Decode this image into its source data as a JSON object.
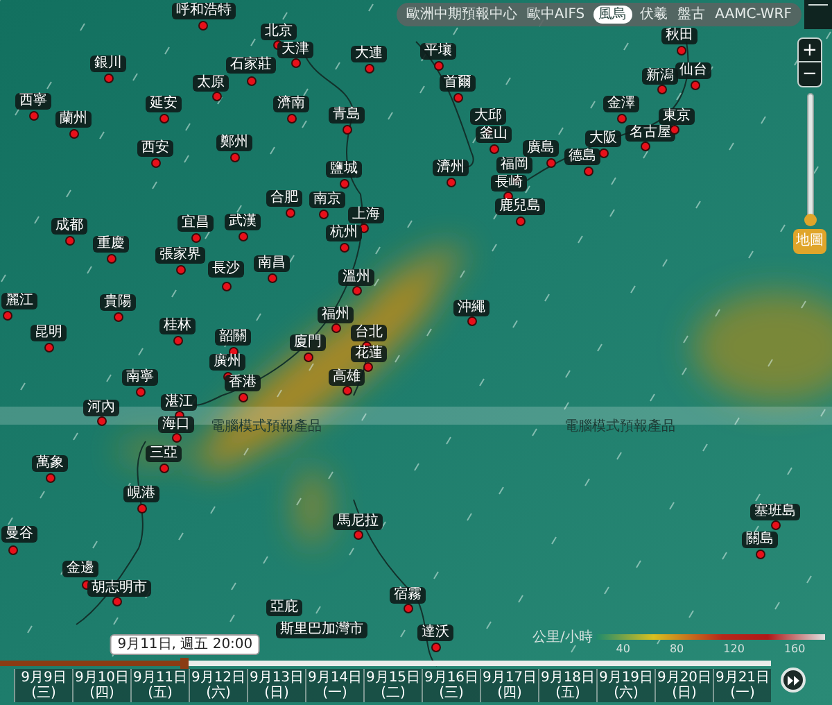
{
  "model_tabs": [
    {
      "label": "歐洲中期預報中心",
      "selected": false
    },
    {
      "label": "歐中AIFS",
      "selected": false
    },
    {
      "label": "風烏",
      "selected": true
    },
    {
      "label": "伏羲",
      "selected": false
    },
    {
      "label": "盤古",
      "selected": false
    },
    {
      "label": "AAMC-WRF",
      "selected": false
    }
  ],
  "zoom_controls": {
    "zoom_in": "+",
    "zoom_out": "−",
    "zoom_level": {
      "level": 0
    }
  },
  "layer_button": "地圖",
  "cities": [
    "呼和浩特",
    "北京",
    "天津",
    "大連",
    "銀川",
    "石家莊",
    "太原",
    "西寧",
    "延安",
    "濟南",
    "蘭州",
    "青島",
    "西安",
    "鄭州",
    "鹽城",
    "合肥",
    "南京",
    "上海",
    "成都",
    "宜昌",
    "武漢",
    "杭州",
    "重慶",
    "張家界",
    "長沙",
    "南昌",
    "溫州",
    "麗江",
    "貴陽",
    "福州",
    "桂林",
    "昆明",
    "韶關",
    "廈門",
    "台北",
    "花蓮",
    "廣州",
    "南寧",
    "香港",
    "高雄",
    "湛江",
    "河內",
    "海口",
    "三亞",
    "萬象",
    "峴港",
    "曼谷",
    "金邊",
    "胡志明市",
    "馬尼拉",
    "宿霧",
    "達沃",
    "亞庇",
    "斯里巴加灣市",
    "沖繩",
    "平壤",
    "首爾",
    "大邱",
    "釜山",
    "濟州",
    "福岡",
    "長崎",
    "鹿兒島",
    "廣島",
    "德島",
    "大阪",
    "名古屋",
    "金澤",
    "新潟",
    "仙台",
    "東京",
    "秋田",
    "塞班島",
    "關島"
  ],
  "overlay_banners": [
    "電腦模式預報產品",
    "電腦模式預報產品"
  ],
  "legend": {
    "unit": "公里/小時",
    "ticks": [
      "40",
      "80",
      "120",
      "160"
    ]
  },
  "timeline": {
    "level": 0.24,
    "tooltip": "9月11日, 週五 20:00",
    "days": [
      {
        "date": "9月9日",
        "weekday": "(三)"
      },
      {
        "date": "9月10日",
        "weekday": "(四)"
      },
      {
        "date": "9月11日",
        "weekday": "(五)"
      },
      {
        "date": "9月12日",
        "weekday": "(六)"
      },
      {
        "date": "9月13日",
        "weekday": "(日)"
      },
      {
        "date": "9月14日",
        "weekday": "(一)"
      },
      {
        "date": "9月15日",
        "weekday": "(二)"
      },
      {
        "date": "9月16日",
        "weekday": "(三)"
      },
      {
        "date": "9月17日",
        "weekday": "(四)"
      },
      {
        "date": "9月18日",
        "weekday": "(五)"
      },
      {
        "date": "9月19日",
        "weekday": "(六)"
      },
      {
        "date": "9月20日",
        "weekday": "(日)"
      },
      {
        "date": "9月21日",
        "weekday": "(一)"
      }
    ]
  }
}
